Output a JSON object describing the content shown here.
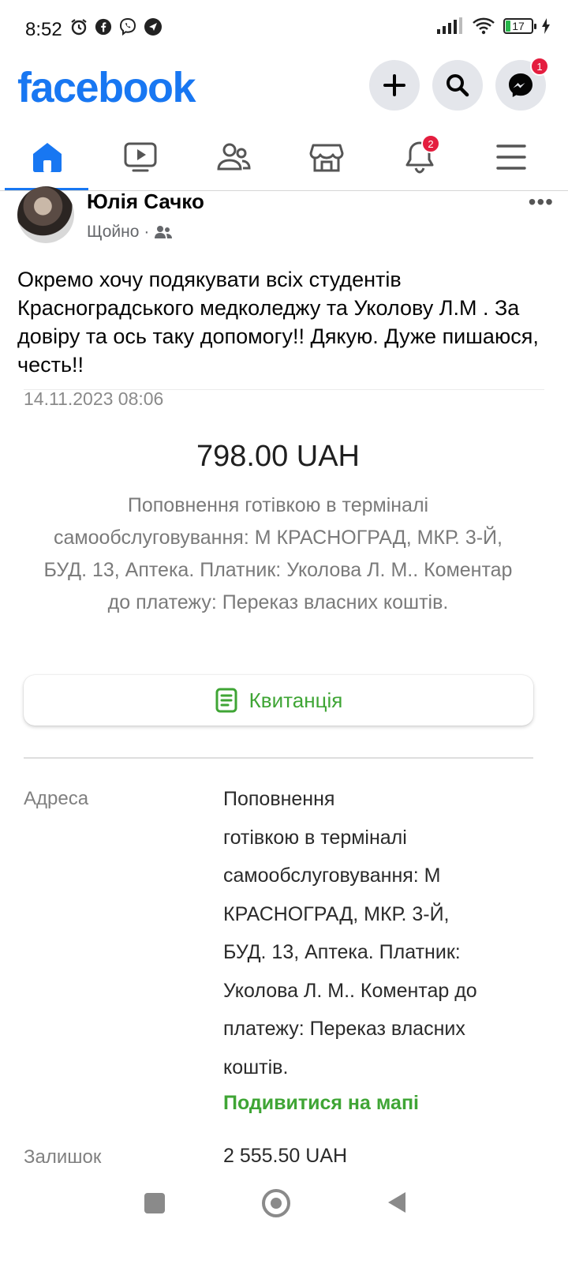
{
  "status_bar": {
    "time": "8:52",
    "battery": "17"
  },
  "header": {
    "logo": "facebook",
    "messenger_badge": "1",
    "brand_color": "#1877f2"
  },
  "nav": {
    "tabs": [
      "home-icon",
      "video-icon",
      "friends-icon",
      "marketplace-icon",
      "notifications-icon",
      "menu-icon"
    ],
    "notifications_badge": "2"
  },
  "post": {
    "author": "Юлія Сачко",
    "time": "Щойно",
    "text": "Окремо хочу подякувати всіх студентів Красноградського медколеджу та Уколову Л.М . За довіру та ось таку допомогу!! Дякую. Дуже пишаюся, честь!!"
  },
  "receipt": {
    "date": "14.11.2023 08:06",
    "amount": "798.00 UAH",
    "description": "Поповнення готівкою в терміналі самообслуговування: М КРАСНОГРАД, МКР. 3-Й, БУД. 13, Аптека. Платник: Уколова Л. М.. Коментар до платежу: Переказ власних коштів.",
    "receipt_button": "Квитанція",
    "address_label": "Адреса",
    "address_lines": [
      "Поповнення",
      "готівкою в терміналі",
      "самообслуговування: М",
      "КРАСНОГРАД, МКР. 3-Й,",
      "БУД. 13, Аптека. Платник:",
      "Уколова Л. М.. Коментар до",
      "платежу: Переказ власних",
      "коштів."
    ],
    "map_link": "Подивитися на мапі",
    "balance_label": "Залишок",
    "balance_value": "2 555.50 UAH",
    "accent_color": "#3fa535"
  }
}
